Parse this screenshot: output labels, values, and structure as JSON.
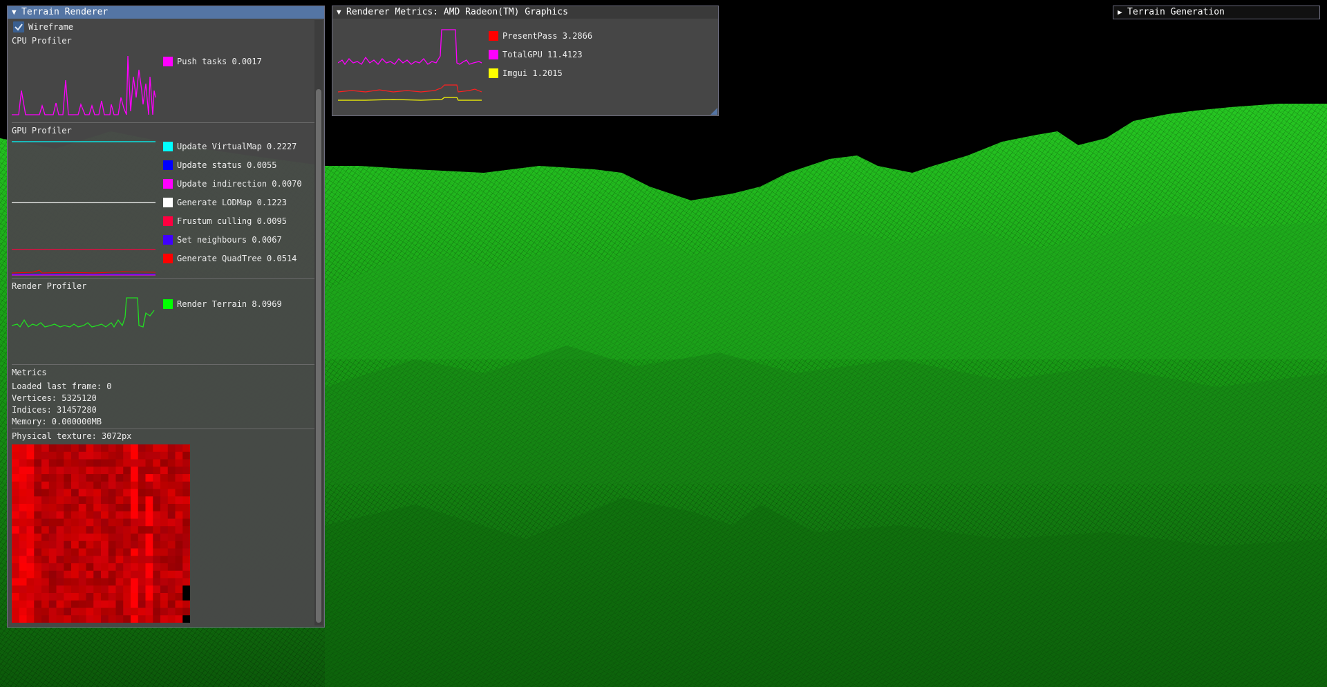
{
  "terrain_renderer": {
    "title": "Terrain Renderer",
    "wireframe": {
      "label": "Wireframe",
      "checked": true
    },
    "cpu_profiler": {
      "title": "CPU Profiler",
      "entries": [
        {
          "label": "Push tasks 0.0017",
          "color": "#ff00ff"
        }
      ]
    },
    "gpu_profiler": {
      "title": "GPU Profiler",
      "entries": [
        {
          "label": "Update VirtualMap 0.2227",
          "color": "#00ffff"
        },
        {
          "label": "Update status 0.0055",
          "color": "#0000ff"
        },
        {
          "label": "Update indirection 0.0070",
          "color": "#ff00ff"
        },
        {
          "label": "Generate LODMap 0.1223",
          "color": "#ffffff"
        },
        {
          "label": "Frustum culling 0.0095",
          "color": "#ff0040"
        },
        {
          "label": "Set neighbours 0.0067",
          "color": "#4000ff"
        },
        {
          "label": "Generate QuadTree 0.0514",
          "color": "#ff0000"
        }
      ]
    },
    "render_profiler": {
      "title": "Render Profiler",
      "entries": [
        {
          "label": "Render Terrain 8.0969",
          "color": "#00ff00"
        }
      ]
    },
    "metrics": {
      "title": "Metrics",
      "loaded": "Loaded last frame: 0",
      "vertices": "Vertices: 5325120",
      "indices": "Indices: 31457280",
      "memory": "Memory: 0.000000MB"
    },
    "physical_texture": {
      "label": "Physical texture: 3072px"
    }
  },
  "renderer_metrics": {
    "title": "Renderer Metrics: AMD Radeon(TM) Graphics",
    "entries": [
      {
        "label": "PresentPass 3.2866",
        "color": "#ff0000"
      },
      {
        "label": "TotalGPU 11.4123",
        "color": "#ff00ff"
      },
      {
        "label": "Imgui 1.2015",
        "color": "#ffff00"
      }
    ]
  },
  "terrain_generation": {
    "title": "Terrain Generation",
    "collapsed": true
  },
  "colors": {
    "terrain": "#1aa818",
    "sky": "#000000",
    "title_active": "#5475a4",
    "window_bg": "#484848"
  },
  "icons": {
    "collapse": "triangle-down-icon",
    "expand": "triangle-right-icon",
    "check": "check-icon"
  }
}
